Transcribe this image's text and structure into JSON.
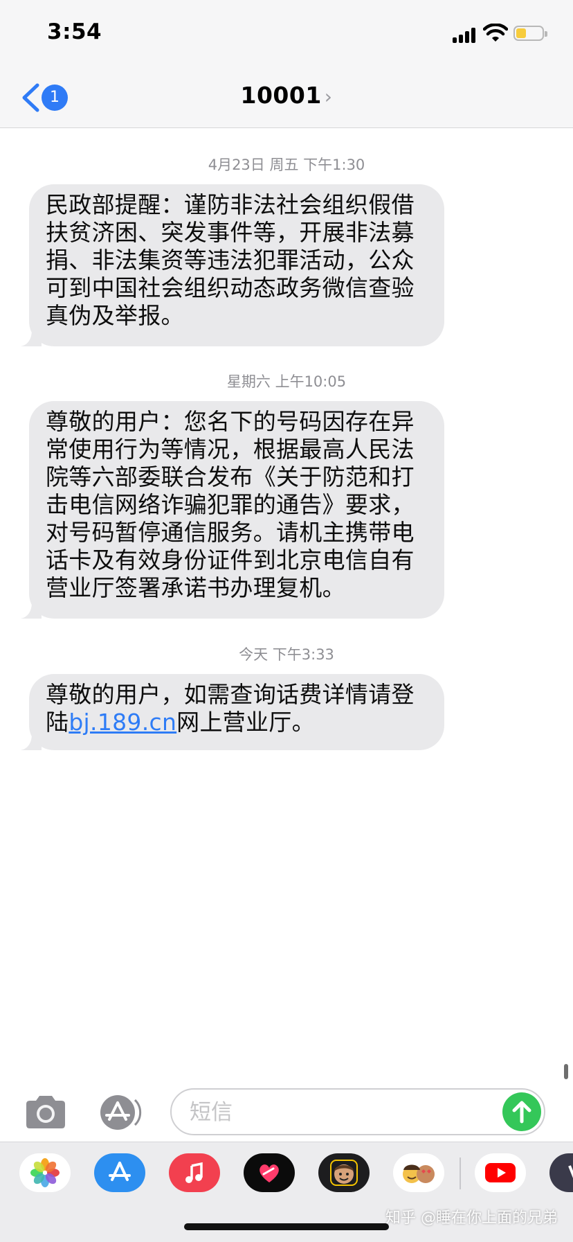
{
  "status_bar": {
    "time": "3:54"
  },
  "header": {
    "back_badge": "1",
    "contact": "10001",
    "contact_chevron": "›"
  },
  "messages": [
    {
      "timestamp": "4月23日 周五 下午1:30",
      "text": "民政部提醒：谨防非法社会组织假借扶贫济困、突发事件等，开展非法募捐、非法集资等违法犯罪活动，公众可到中国社会组织动态政务微信查验真伪及举报。"
    },
    {
      "timestamp": "星期六 上午10:05",
      "text": "尊敬的用户：您名下的号码因存在异常使用行为等情况，根据最高人民法院等六部委联合发布《关于防范和打击电信网络诈骗犯罪的通告》要求，对号码暂停通信服务。请机主携带电话卡及有效身份证件到北京电信自有营业厅签署承诺书办理复机。"
    },
    {
      "timestamp": "今天 下午3:33",
      "text_before_link": "尊敬的用户，如需查询话费详情请登陆",
      "link": "bj.189.cn",
      "text_after_link": "网上营业厅。"
    }
  ],
  "compose": {
    "placeholder": "短信"
  },
  "app_drawer": {
    "apps": [
      "photos-icon",
      "app-store-icon",
      "music-icon",
      "digital-touch-icon",
      "memoji-icon",
      "memoji-stickers-icon",
      "youtube-icon",
      "more-app-icon"
    ]
  },
  "colors": {
    "accent": "#2e7cf6",
    "bubble": "#e9e9eb",
    "send": "#34c759",
    "timestamp": "#8e8e93"
  },
  "watermark": "知乎 @睡在你上面的兄弟"
}
